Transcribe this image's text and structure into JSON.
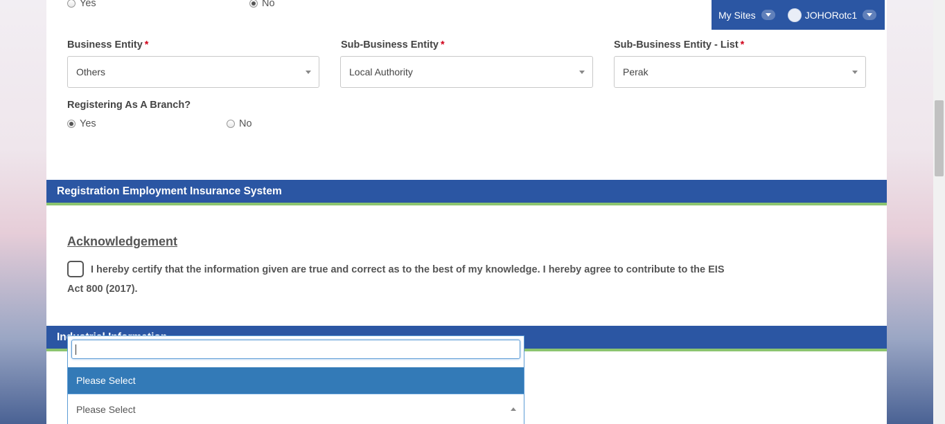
{
  "top_radio": {
    "yes_label": "Yes",
    "no_label": "No"
  },
  "topbar": {
    "my_sites": "My Sites",
    "user": "JOHORotc1"
  },
  "fields": {
    "business_entity": {
      "label": "Business Entity",
      "value": "Others"
    },
    "sub_business_entity": {
      "label": "Sub-Business Entity",
      "value": "Local Authority"
    },
    "sub_business_entity_list": {
      "label": "Sub-Business Entity - List",
      "value": "Perak"
    },
    "required_mark": "*"
  },
  "branch": {
    "question": "Registering As A Branch?",
    "yes_label": "Yes",
    "no_label": "No"
  },
  "sections": {
    "eis": "Registration Employment Insurance System",
    "industrial": "Industrial Information"
  },
  "acknowledgement": {
    "title": "Acknowledgement",
    "text": "I hereby certify that the information given are true and correct as to the best of my knowledge. I hereby agree to contribute to the EIS Act 800 (2017)."
  },
  "dropdown": {
    "search_value": "",
    "highlighted_option": "Please Select",
    "selected_value": "Please Select"
  },
  "colors": {
    "header_blue": "#2b56a3",
    "accent_green": "#8cc56f",
    "highlight": "#337ab7",
    "required": "#d0021b"
  }
}
